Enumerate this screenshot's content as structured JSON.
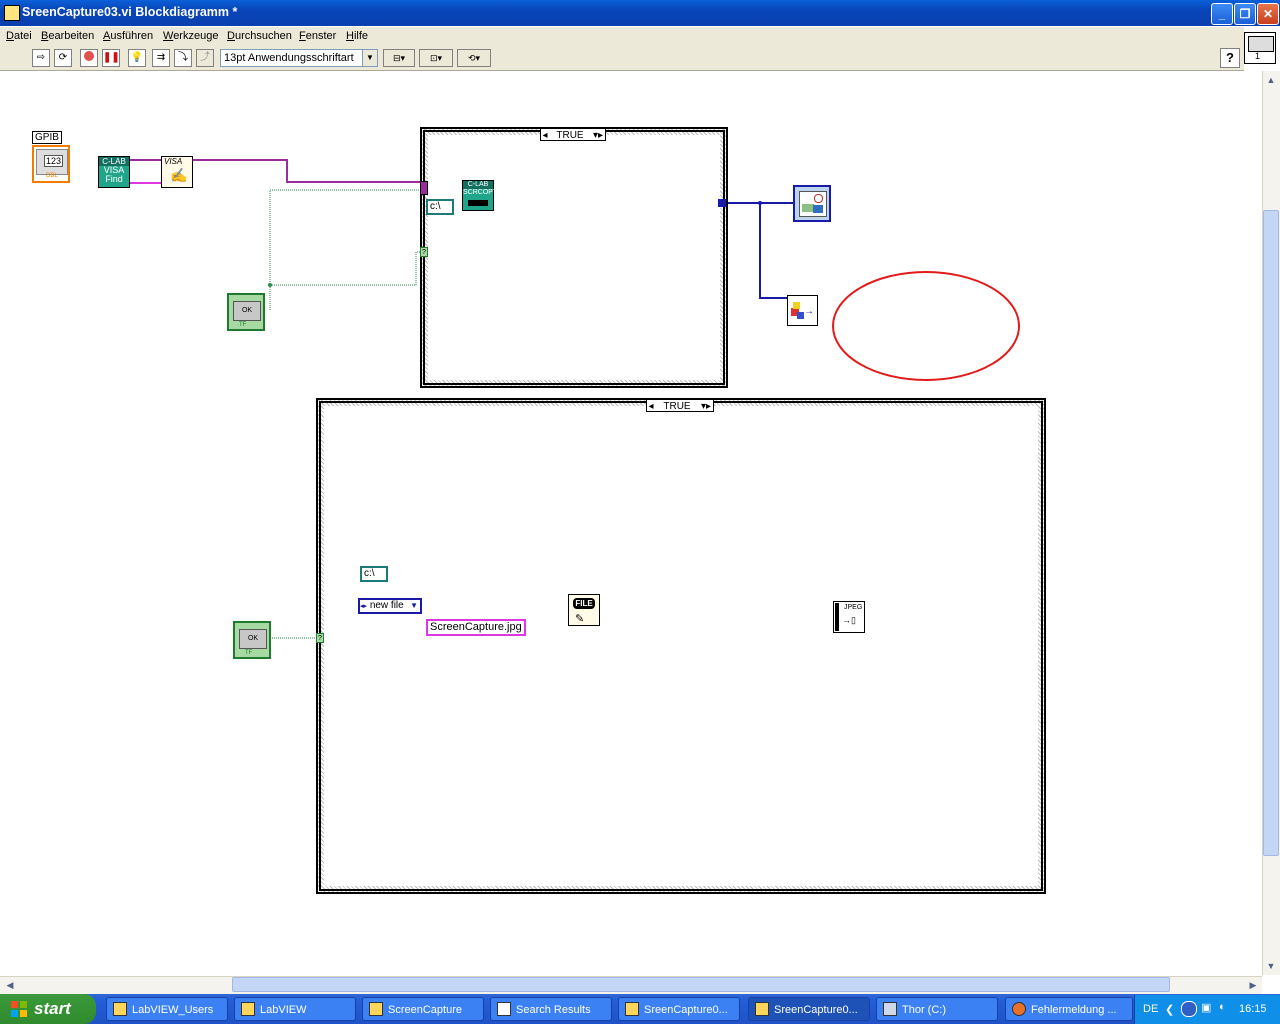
{
  "window": {
    "title": "SreenCapture03.vi Blockdiagramm *",
    "min": "_",
    "max": "❐",
    "close": "✕"
  },
  "menu": [
    "Datei",
    "Bearbeiten",
    "Ausführen",
    "Werkzeuge",
    "Durchsuchen",
    "Fenster",
    "Hilfe"
  ],
  "toolbar": {
    "font": "13pt Anwendungsschriftart",
    "help": "?"
  },
  "vi_icon_label": "1",
  "diagram": {
    "gpib_label": "GPIB",
    "numeric_value": "123",
    "numeric_type": "DBL",
    "visa_find": {
      "line1": "C-LAB",
      "line2": "VISA",
      "line3": "Find"
    },
    "visa_label": "VISA",
    "bool_ok": "OK",
    "bool_tf": "TF",
    "case1_selector": "TRUE",
    "scrcopy": {
      "line1": "C-LAB",
      "line2": "SCRCOPY"
    },
    "path_const": "c:\\",
    "case2_selector": "TRUE",
    "enum_new_file": "new file",
    "filename": "ScreenCapture.jpg",
    "file_label": "FILE",
    "jpeg_label": "JPEG"
  },
  "taskbar": {
    "start": "start",
    "tasks": [
      "LabVIEW_Users",
      "LabVIEW",
      "ScreenCapture",
      "Search Results",
      "SreenCapture0...",
      "SreenCapture0...",
      "Thor (C:)",
      "Fehlermeldung ..."
    ],
    "lang": "DE",
    "clock": "16:15"
  },
  "colors": {
    "wire_purple": "#9b2a9b",
    "wire_blue": "#1a1aa8",
    "wire_green": "#2c8a4d",
    "wire_teal": "#1d7a78",
    "wire_pink": "#e036e0",
    "annotation_red": "#e21a1a"
  }
}
